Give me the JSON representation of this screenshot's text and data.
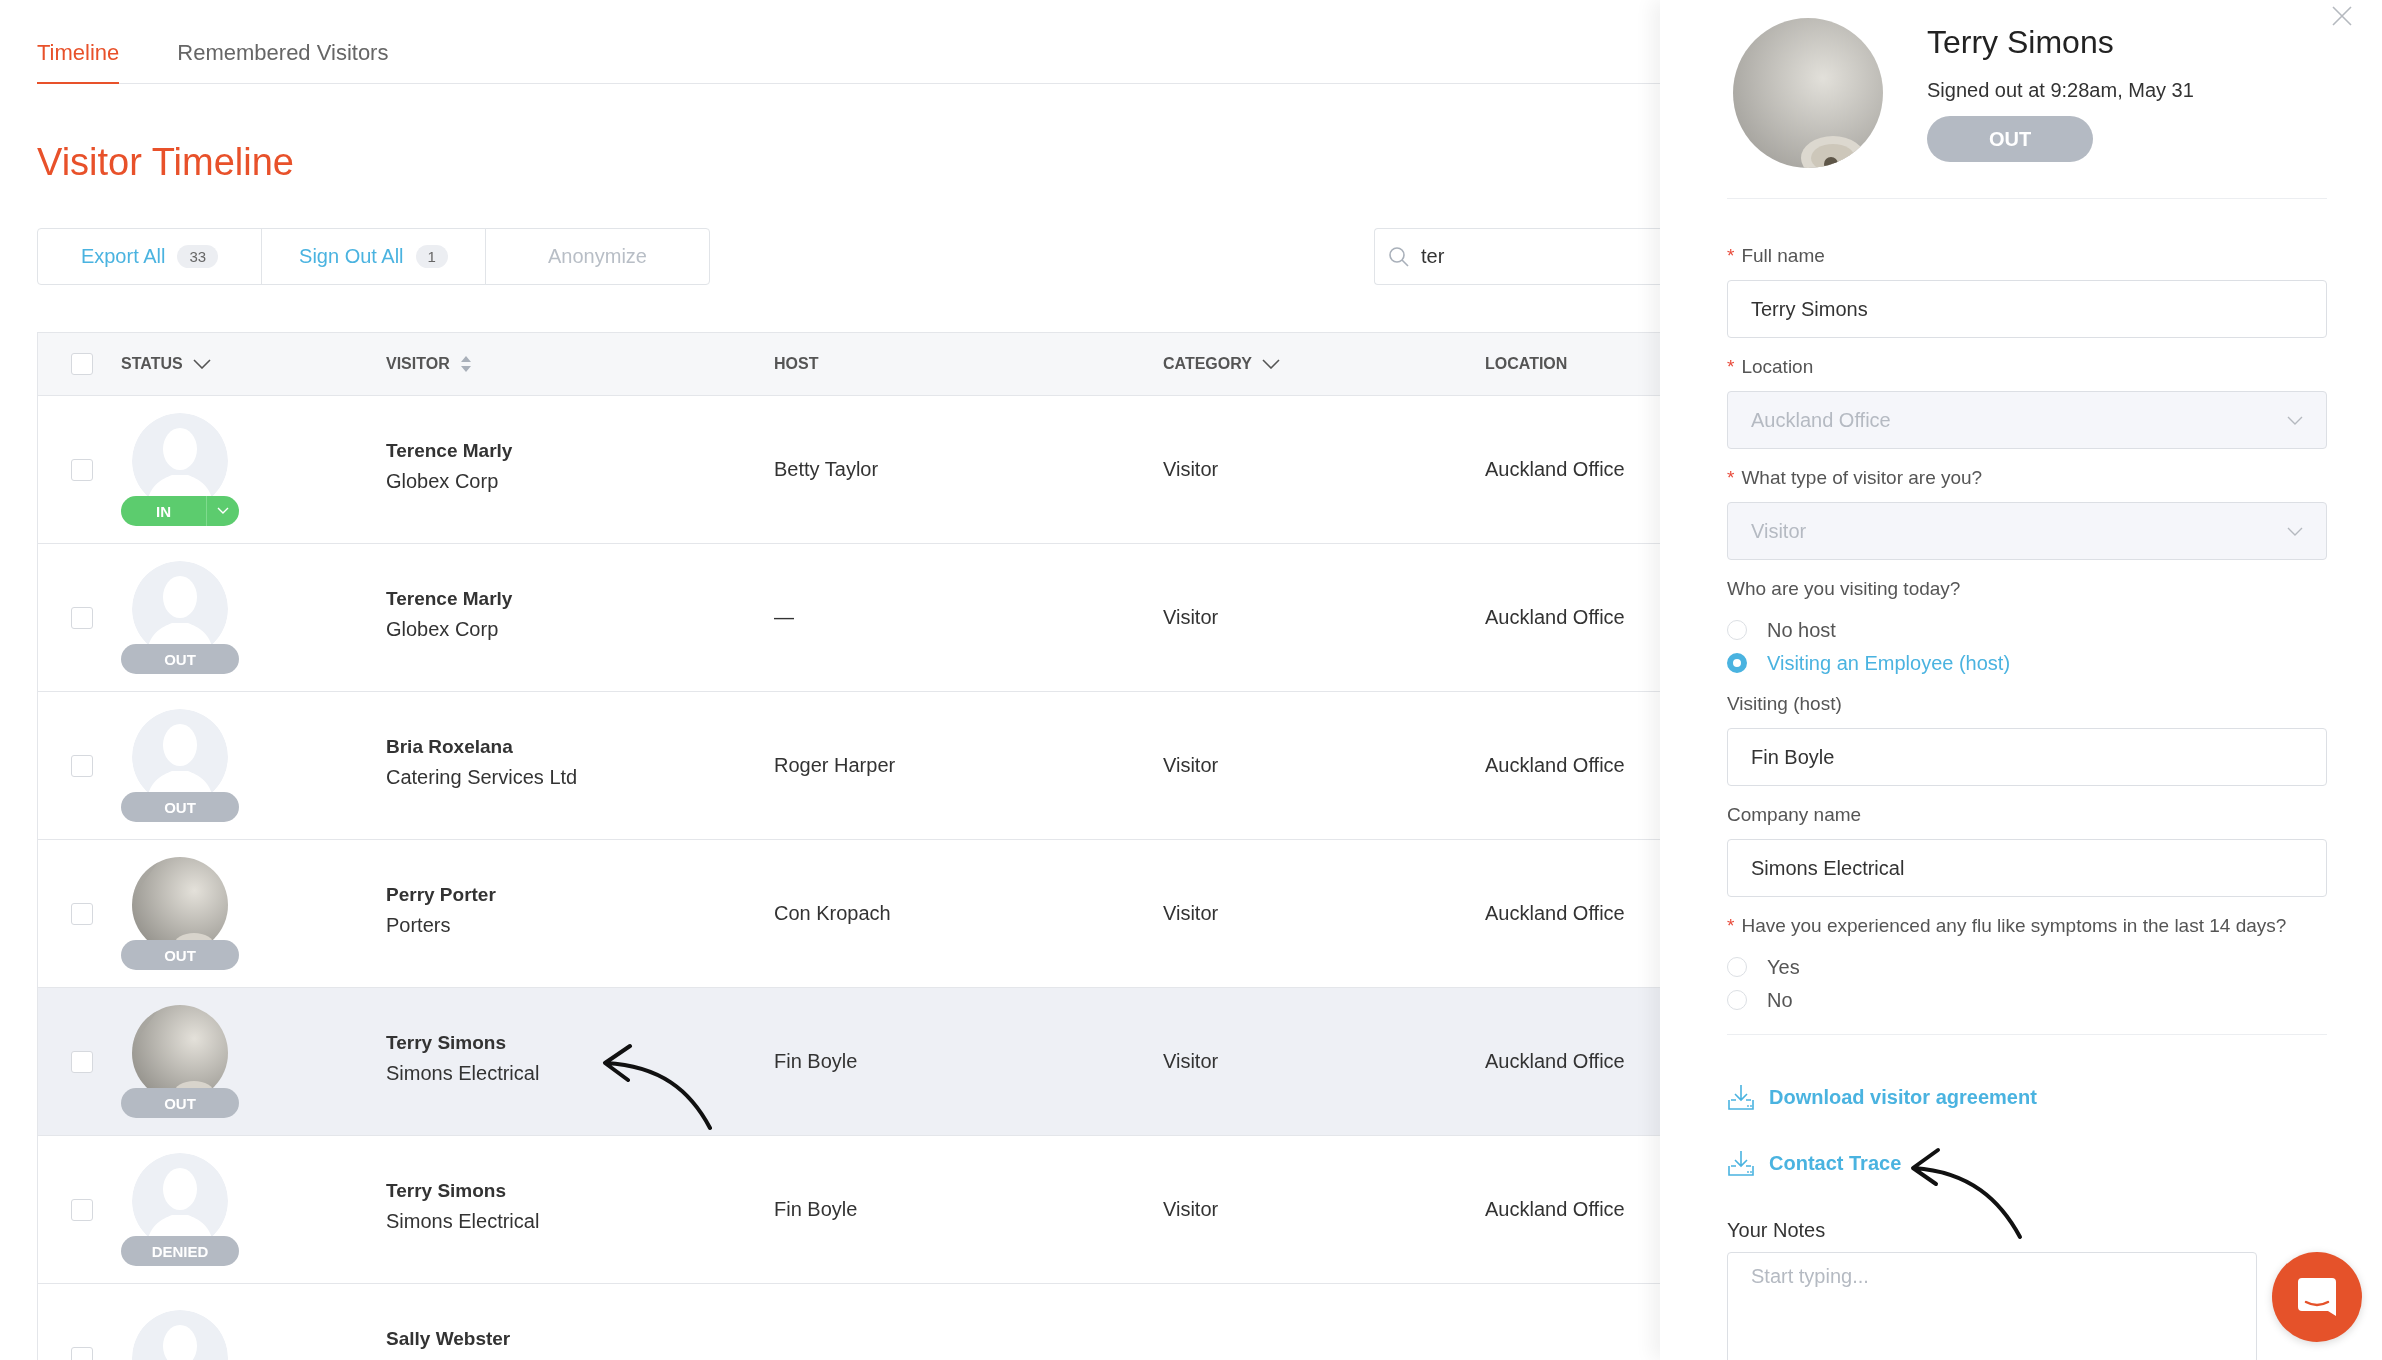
{
  "tabs": [
    {
      "label": "Timeline",
      "selected": true
    },
    {
      "label": "Remembered Visitors",
      "selected": false
    }
  ],
  "title": "Visitor Timeline",
  "toolbar": [
    {
      "label": "Export All",
      "count": "33",
      "disabled": false
    },
    {
      "label": "Sign Out All",
      "count": "1",
      "disabled": false
    },
    {
      "label": "Anonymize",
      "disabled": true
    }
  ],
  "search": {
    "value": "ter"
  },
  "table": {
    "select_all_checked": false,
    "columns": [
      {
        "label": "STATUS",
        "kind": "filter"
      },
      {
        "label": "VISITOR",
        "kind": "sort"
      },
      {
        "label": "HOST",
        "kind": "plain"
      },
      {
        "label": "CATEGORY",
        "kind": "filter"
      },
      {
        "label": "LOCATION",
        "kind": "plain"
      }
    ],
    "rows": [
      {
        "status": {
          "label": "IN",
          "kind": "in"
        },
        "avatar": {
          "kind": "silhouette"
        },
        "name": "Terence Marly",
        "company": "Globex Corp",
        "host": "Betty Taylor",
        "category": "Visitor",
        "location": "Auckland Office",
        "selected": false,
        "checked": false
      },
      {
        "status": {
          "label": "OUT",
          "kind": "out"
        },
        "avatar": {
          "kind": "silhouette"
        },
        "name": "Terence Marly",
        "company": "Globex Corp",
        "host": "—",
        "category": "Visitor",
        "location": "Auckland Office",
        "selected": false,
        "checked": false
      },
      {
        "status": {
          "label": "OUT",
          "kind": "out"
        },
        "avatar": {
          "kind": "silhouette"
        },
        "name": "Bria Roxelana",
        "company": "Catering Services Ltd",
        "host": "Roger Harper",
        "category": "Visitor",
        "location": "Auckland Office",
        "selected": false,
        "checked": false
      },
      {
        "status": {
          "label": "OUT",
          "kind": "out"
        },
        "name": "Perry Porter",
        "company": "Porters",
        "host": "Con Kropach",
        "category": "Visitor",
        "location": "Auckland Office",
        "selected": false,
        "checked": false
      },
      {
        "status": {
          "label": "OUT",
          "kind": "out"
        },
        "name": "Terry Simons",
        "company": "Simons Electrical",
        "host": "Fin Boyle",
        "category": "Visitor",
        "location": "Auckland Office",
        "selected": true,
        "checked": false
      },
      {
        "status": {
          "label": "DENIED",
          "kind": "denied"
        },
        "avatar": {
          "kind": "silhouette"
        },
        "name": "Terry Simons",
        "company": "Simons Electrical",
        "host": "Fin Boyle",
        "category": "Visitor",
        "location": "Auckland Office",
        "selected": false,
        "checked": false
      },
      {
        "avatar": {
          "kind": "silhouette"
        },
        "name": "Sally Webster",
        "selected": false,
        "checked": false
      }
    ]
  },
  "panel": {
    "name": "Terry Simons",
    "subtitle": "Signed out at 9:28am, May 31",
    "status": "OUT",
    "fields": [
      {
        "kind": "text",
        "required_mark": "*",
        "label": "Full name",
        "value": "Terry Simons"
      },
      {
        "kind": "select",
        "required_mark": "*",
        "label": "Location",
        "value": "Auckland Office",
        "disabled": true
      },
      {
        "kind": "select",
        "required_mark": "*",
        "label": "What type of visitor are you?",
        "value": "Visitor",
        "disabled": true
      },
      {
        "kind": "radio",
        "label": "Who are you visiting today?",
        "options": [
          {
            "label": "No host",
            "selected": false
          },
          {
            "label": "Visiting an Employee (host)",
            "selected": true
          }
        ]
      },
      {
        "kind": "text",
        "label": "Visiting (host)",
        "value": "Fin Boyle"
      },
      {
        "kind": "text",
        "label": "Company name",
        "value": "Simons Electrical"
      },
      {
        "kind": "radio",
        "required_mark": "*",
        "label": "Have you experienced any flu like symptoms in the last 14 days?",
        "options": [
          {
            "label": "Yes",
            "selected": false
          },
          {
            "label": "No",
            "selected": false
          }
        ]
      }
    ],
    "links": [
      "Download visitor agreement",
      "Contact Trace"
    ],
    "notes": {
      "label": "Your Notes",
      "placeholder": "Start typing..."
    }
  }
}
